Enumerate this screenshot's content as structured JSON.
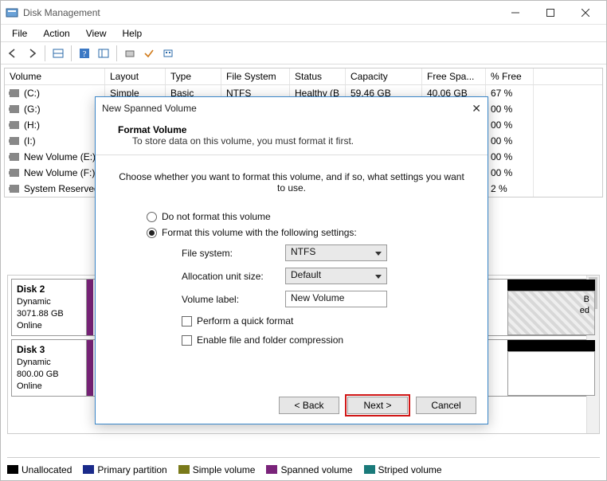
{
  "window": {
    "title": "Disk Management",
    "menus": [
      "File",
      "Action",
      "View",
      "Help"
    ]
  },
  "table": {
    "headers": {
      "volume": "Volume",
      "layout": "Layout",
      "type": "Type",
      "fs": "File System",
      "status": "Status",
      "cap": "Capacity",
      "free": "Free Spa...",
      "pfree": "% Free"
    },
    "rows": [
      {
        "vol": "(C:)",
        "layout": "Simple",
        "type": "Basic",
        "fs": "NTFS",
        "status": "Healthy (B",
        "cap": "59.46 GB",
        "free": "40.06 GB",
        "pfree": "67 %"
      },
      {
        "vol": "(G:)",
        "pfree": "00 %"
      },
      {
        "vol": "(H:)",
        "pfree": "00 %"
      },
      {
        "vol": "(I:)",
        "pfree": "00 %"
      },
      {
        "vol": "New Volume (E:)",
        "pfree": "00 %"
      },
      {
        "vol": "New Volume (F:)",
        "pfree": "00 %"
      },
      {
        "vol": "System Reserved",
        "pfree": "2 %"
      }
    ]
  },
  "disks": [
    {
      "name": "Disk 2",
      "type": "Dynamic",
      "size": "3071.88 GB",
      "state": "Online",
      "rightLabel1": "B",
      "rightLabel2": "ed"
    },
    {
      "name": "Disk 3",
      "type": "Dynamic",
      "size": "800.00 GB",
      "state": "Online"
    }
  ],
  "legend": {
    "unallocated": "Unallocated",
    "primary": "Primary partition",
    "simple": "Simple volume",
    "spanned": "Spanned volume",
    "striped": "Striped volume"
  },
  "dialog": {
    "title": "New Spanned Volume",
    "header_title": "Format Volume",
    "header_sub": "To store data on this volume, you must format it first.",
    "instruction": "Choose whether you want to format this volume, and if so, what settings you want to use.",
    "radio_no": "Do not format this volume",
    "radio_yes": "Format this volume with the following settings:",
    "fs_label": "File system:",
    "fs_value": "NTFS",
    "aus_label": "Allocation unit size:",
    "aus_value": "Default",
    "vol_label": "Volume label:",
    "vol_value": "New Volume",
    "chk_quick": "Perform a quick format",
    "chk_compress": "Enable file and folder compression",
    "back": "< Back",
    "next": "Next >",
    "cancel": "Cancel"
  }
}
